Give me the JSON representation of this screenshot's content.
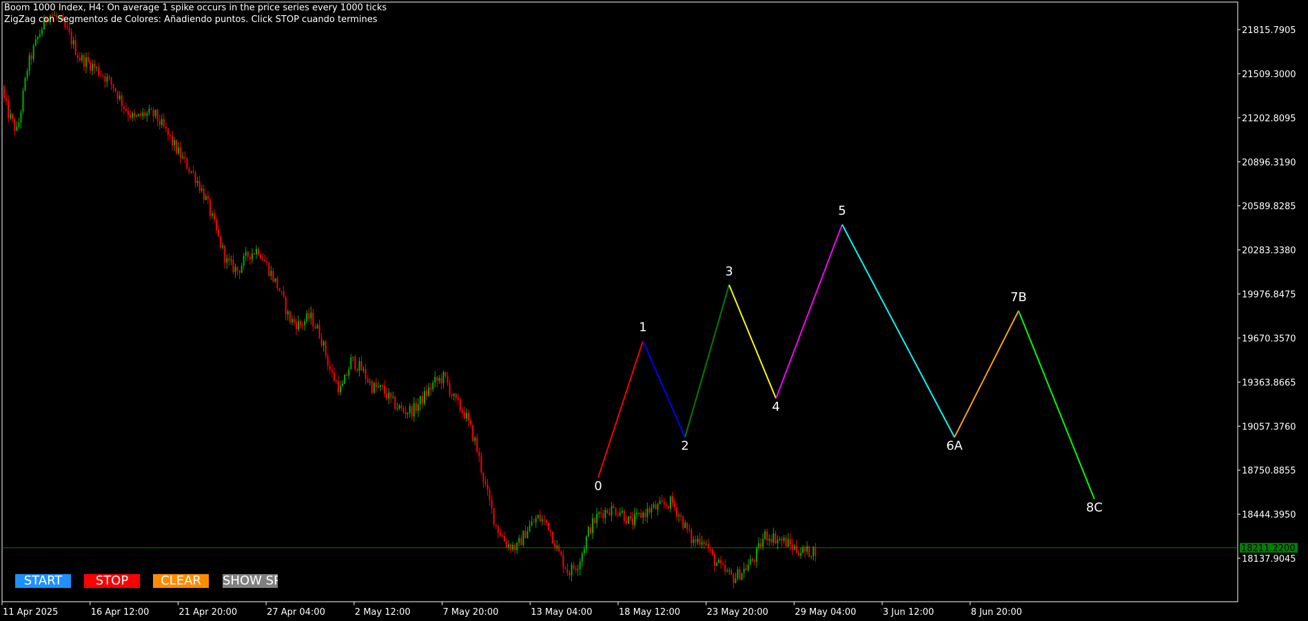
{
  "header": {
    "line1": "Boom 1000 Index, H4:  On average 1 spike occurs in the price series every 1000 ticks",
    "line2": "ZigZag con Segmentos de Colores: Añadiendo puntos. Click STOP cuando termines"
  },
  "buttons": [
    {
      "id": "start",
      "label": "START",
      "color": "#1e90ff"
    },
    {
      "id": "stop",
      "label": "STOP",
      "color": "#ff0000"
    },
    {
      "id": "clear",
      "label": "CLEAR",
      "color": "#ff8c00"
    },
    {
      "id": "show",
      "label": "SHOW SPIKES",
      "color": "#808080"
    }
  ],
  "chart_data": {
    "type": "candlestick",
    "symbol": "Boom 1000 Index",
    "timeframe": "H4",
    "ylim": [
      17960,
      21980
    ],
    "y_ticks": [
      "21815.7905",
      "21509.3000",
      "21202.8095",
      "20896.3190",
      "20589.8285",
      "20283.3380",
      "19976.8475",
      "19670.3570",
      "19363.8665",
      "19057.3760",
      "18750.8855",
      "18444.3950",
      "18137.9045"
    ],
    "x_ticks": [
      "11 Apr 2025",
      "16 Apr 12:00",
      "21 Apr 20:00",
      "27 Apr 04:00",
      "2 May 12:00",
      "7 May 20:00",
      "13 May 04:00",
      "18 May 12:00",
      "23 May 20:00",
      "29 May 04:00",
      "3 Jun 12:00",
      "8 Jun 20:00"
    ],
    "current_price": "18211.2200",
    "price_path": [
      [
        0,
        21420
      ],
      [
        12,
        21230
      ],
      [
        25,
        21100
      ],
      [
        40,
        21560
      ],
      [
        55,
        21760
      ],
      [
        70,
        21930
      ],
      [
        85,
        21890
      ],
      [
        100,
        21780
      ],
      [
        115,
        21620
      ],
      [
        130,
        21580
      ],
      [
        150,
        21500
      ],
      [
        165,
        21420
      ],
      [
        180,
        21280
      ],
      [
        195,
        21190
      ],
      [
        210,
        21230
      ],
      [
        225,
        21220
      ],
      [
        240,
        21110
      ],
      [
        255,
        20990
      ],
      [
        270,
        20880
      ],
      [
        285,
        20780
      ],
      [
        300,
        20620
      ],
      [
        315,
        20390
      ],
      [
        330,
        20190
      ],
      [
        345,
        20140
      ],
      [
        360,
        20250
      ],
      [
        375,
        20290
      ],
      [
        390,
        20150
      ],
      [
        405,
        20010
      ],
      [
        420,
        19800
      ],
      [
        435,
        19760
      ],
      [
        450,
        19820
      ],
      [
        465,
        19690
      ],
      [
        480,
        19430
      ],
      [
        495,
        19300
      ],
      [
        510,
        19520
      ],
      [
        525,
        19450
      ],
      [
        540,
        19330
      ],
      [
        555,
        19310
      ],
      [
        570,
        19220
      ],
      [
        585,
        19160
      ],
      [
        600,
        19170
      ],
      [
        615,
        19260
      ],
      [
        630,
        19360
      ],
      [
        645,
        19400
      ],
      [
        660,
        19230
      ],
      [
        675,
        19140
      ],
      [
        690,
        18940
      ],
      [
        705,
        18620
      ],
      [
        720,
        18360
      ],
      [
        735,
        18240
      ],
      [
        750,
        18210
      ],
      [
        765,
        18340
      ],
      [
        780,
        18420
      ],
      [
        795,
        18380
      ],
      [
        810,
        18180
      ],
      [
        825,
        18040
      ],
      [
        840,
        18110
      ],
      [
        855,
        18340
      ],
      [
        870,
        18450
      ],
      [
        885,
        18480
      ],
      [
        900,
        18470
      ],
      [
        915,
        18380
      ],
      [
        930,
        18440
      ],
      [
        945,
        18480
      ],
      [
        960,
        18500
      ],
      [
        975,
        18530
      ],
      [
        990,
        18400
      ],
      [
        1005,
        18250
      ],
      [
        1020,
        18280
      ],
      [
        1035,
        18130
      ],
      [
        1050,
        18050
      ],
      [
        1065,
        18000
      ],
      [
        1080,
        18060
      ],
      [
        1095,
        18140
      ],
      [
        1110,
        18300
      ],
      [
        1125,
        18280
      ],
      [
        1140,
        18250
      ],
      [
        1155,
        18200
      ],
      [
        1170,
        18180
      ],
      [
        1185,
        18200
      ]
    ],
    "zigzag": [
      {
        "label": "0",
        "value": 18700
      },
      {
        "label": "1",
        "value": 19650
      },
      {
        "label": "2",
        "value": 18980
      },
      {
        "label": "3",
        "value": 20040
      },
      {
        "label": "4",
        "value": 19250
      },
      {
        "label": "5",
        "value": 20460
      },
      {
        "label": "6A",
        "value": 18980
      },
      {
        "label": "7B",
        "value": 19860
      },
      {
        "label": "8C",
        "value": 18550
      }
    ],
    "segment_colors": [
      "#ff0000",
      "#0000ff",
      "#008000",
      "#ffff00",
      "#ff00ff",
      "#00ffff",
      "#ffa500",
      "#00ff00"
    ],
    "bull_color": "#00b300",
    "bear_color": "#ff0000"
  }
}
